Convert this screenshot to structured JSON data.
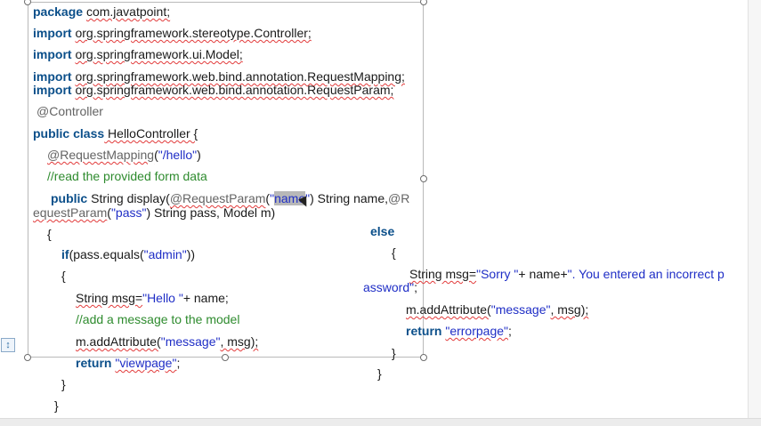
{
  "document": {
    "left_code": {
      "package_kw": "package",
      "package_name": "com.javatpoint;",
      "import1_kw": "import",
      "import1_path": "org.springframework.stereotype.Controller;",
      "import2_kw": "import",
      "import2_path": "org.springframework.ui.Model;",
      "import3_kw": "import",
      "import3_path": " org.springframework.web.bind.annotation.RequestMapping;",
      "import4_kw": "import",
      "import4_path": "org.springframework.web.bind.annotation.RequestParam;",
      "controller_annotation": "@Controller",
      "class_kw": "public class",
      "class_name": " HelloController {",
      "mapping_annotation": "@RequestMapping",
      "mapping_open": "(",
      "mapping_path": "\"/hello\"",
      "mapping_close": ")",
      "comment_form": "//read the provided form data",
      "method_kw": "public",
      "method_sig_a": " String display(",
      "param_annotation_a": "@RequestParam",
      "param_open_a": "(",
      "param_quote_open": "\"",
      "param_name_selected": "name",
      "param_quote_close": "\"",
      "method_sig_b": ") String name,",
      "param_annotation_b_start": "@R",
      "param_annotation_b_end": "equestParam",
      "param_open_b": "(",
      "param_name_pass": "\"pass\"",
      "method_sig_c": ") String pass, Model m)",
      "brace_open_method": "{",
      "if_kw": "if",
      "if_cond_a": "(pass.equals(",
      "if_admin": "\"admin\"",
      "if_cond_b": "))",
      "brace_open_if": "{",
      "msg_decl": "String msg=",
      "msg_hello": "\"Hello \"",
      "msg_concat": "+ name;",
      "comment_add": "//add a message to the model",
      "add_attr_a": "m.addAttribute(",
      "add_attr_message": "\"message\"",
      "add_attr_b": ", msg);",
      "return_kw": "return",
      "return_viewpage": "\"viewpage\"",
      "return_semicolon": ";",
      "brace_close_if": "}",
      "brace_close_method": "}"
    },
    "right_code": {
      "else_kw": "else",
      "brace_open_else": "{",
      "sorry_decl": "String msg=",
      "sorry_str_a": "\"Sorry \"",
      "sorry_concat": "+ name+",
      "sorry_str_b": "\". You entered an incorrect p",
      "sorry_str_c": "assword\"",
      "sorry_semicolon": ";",
      "add_attr_a": "m.addAttribute(",
      "add_attr_message": "\"message\"",
      "add_attr_b": ", msg);",
      "return_kw": "return",
      "return_errorpage": "\"errorpage\"",
      "return_semicolon": ";",
      "brace_close_inner": "}",
      "brace_close_outer": "}"
    },
    "colors": {
      "keyword": "#0b4f8a",
      "string": "#1f2ec6",
      "comment": "#2e8b2e",
      "annotation": "#646464",
      "spell_squiggle": "#e23b3b",
      "selection": "#b8b8b8"
    },
    "icons": {
      "layout_options": "layout-options-icon",
      "cursor": "mouse-cursor-icon"
    }
  }
}
